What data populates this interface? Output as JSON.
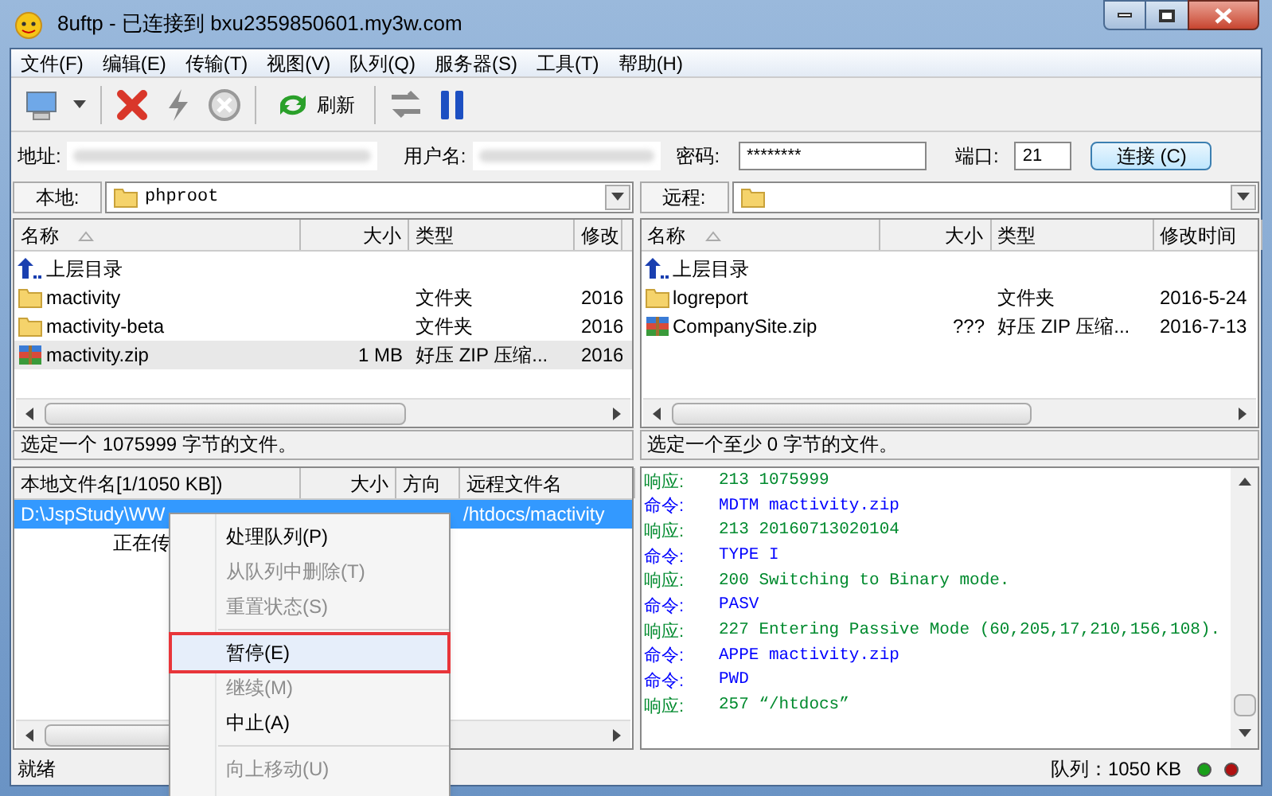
{
  "window": {
    "title": "8uftp - 已连接到 bxu2359850601.my3w.com"
  },
  "menu": [
    "文件(F)",
    "编辑(E)",
    "传输(T)",
    "视图(V)",
    "队列(Q)",
    "服务器(S)",
    "工具(T)",
    "帮助(H)"
  ],
  "toolbar": {
    "refresh_label": "刷新"
  },
  "connection": {
    "address_label": "地址:",
    "username_label": "用户名:",
    "password_label": "密码:",
    "password": "********",
    "port_label": "端口:",
    "port": "21",
    "connect_button": "连接 (C)"
  },
  "local": {
    "label": "本地:",
    "path": "phproot",
    "columns": [
      "名称",
      "大小",
      "类型",
      "修改"
    ],
    "rows": [
      {
        "kind": "up",
        "name": "上层目录",
        "selected": false
      },
      {
        "kind": "folder",
        "name": "mactivity",
        "type": "文件夹",
        "modified": "2016",
        "selected": false
      },
      {
        "kind": "folder",
        "name": "mactivity-beta",
        "type": "文件夹",
        "modified": "2016",
        "selected": false
      },
      {
        "kind": "zip",
        "name": "mactivity.zip",
        "size": "1 MB",
        "type": "好压 ZIP 压缩...",
        "modified": "2016",
        "selected": true
      }
    ],
    "status": "选定一个 1075999 字节的文件。"
  },
  "remote": {
    "label": "远程:",
    "columns": [
      "名称",
      "大小",
      "类型",
      "修改时间"
    ],
    "rows": [
      {
        "kind": "up",
        "name": "上层目录",
        "selected": false
      },
      {
        "kind": "folder",
        "name": "logreport",
        "type": "文件夹",
        "modified": "2016-5-24",
        "selected": false
      },
      {
        "kind": "zip",
        "name": "CompanySite.zip",
        "size": "???",
        "type": "好压 ZIP 压缩...",
        "modified": "2016-7-13",
        "selected": false
      }
    ],
    "status": "选定一个至少 0 字节的文件。"
  },
  "queue": {
    "columns": [
      "本地文件名[1/1050 KB])",
      "大小",
      "方向",
      "远程文件名"
    ],
    "rows": [
      {
        "local": "D:\\JspStudy\\WW",
        "remote": "/htdocs/mactivity",
        "selected": true
      }
    ],
    "progress_text": "正在传"
  },
  "log": [
    {
      "kind": "response",
      "label": "响应:",
      "text": "213 1075999"
    },
    {
      "kind": "command",
      "label": "命令:",
      "text": "MDTM mactivity.zip"
    },
    {
      "kind": "response",
      "label": "响应:",
      "text": "213 20160713020104"
    },
    {
      "kind": "command",
      "label": "命令:",
      "text": "TYPE I"
    },
    {
      "kind": "response",
      "label": "响应:",
      "text": "200 Switching to Binary mode."
    },
    {
      "kind": "command",
      "label": "命令:",
      "text": "PASV"
    },
    {
      "kind": "response",
      "label": "响应:",
      "text": "227 Entering Passive Mode (60,205,17,210,156,108)."
    },
    {
      "kind": "command",
      "label": "命令:",
      "text": "APPE mactivity.zip"
    },
    {
      "kind": "command",
      "label": "命令:",
      "text": "PWD"
    },
    {
      "kind": "response",
      "label": "响应:",
      "text": "257 “/htdocs”"
    }
  ],
  "context_menu": [
    {
      "kind": "item",
      "label": "处理队列(P)",
      "disabled": false,
      "selected": false
    },
    {
      "kind": "item",
      "label": "从队列中删除(T)",
      "disabled": true,
      "selected": false
    },
    {
      "kind": "item",
      "label": "重置状态(S)",
      "disabled": true,
      "selected": false
    },
    {
      "kind": "separator"
    },
    {
      "kind": "item",
      "label": "暂停(E)",
      "disabled": false,
      "selected": true
    },
    {
      "kind": "item",
      "label": "继续(M)",
      "disabled": true,
      "selected": false
    },
    {
      "kind": "item",
      "label": "中止(A)",
      "disabled": false,
      "selected": false
    },
    {
      "kind": "separator"
    },
    {
      "kind": "item",
      "label": "向上移动(U)",
      "disabled": true,
      "selected": false
    }
  ],
  "status_bar": {
    "state": "就绪",
    "queue": "队列：1050 KB"
  }
}
